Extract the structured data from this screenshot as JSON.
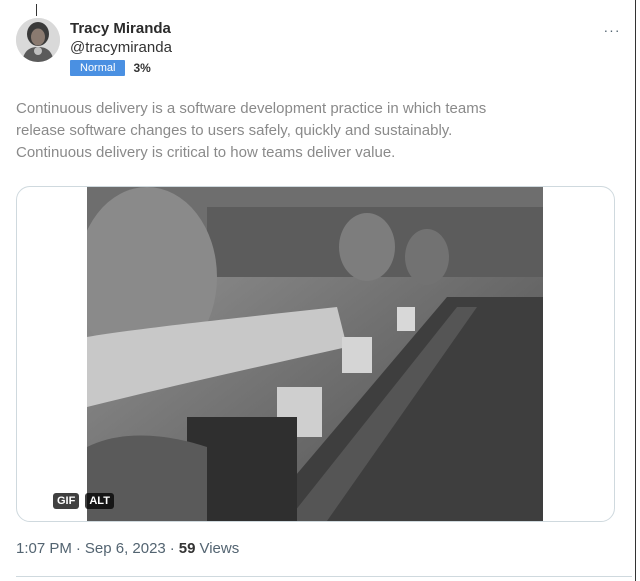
{
  "author": {
    "display_name": "Tracy Miranda",
    "handle": "@tracymiranda",
    "badge": "Normal",
    "score": "3%"
  },
  "more_button": {
    "label": "···",
    "icon": "more-horizontal-icon"
  },
  "tweet": {
    "text": "Continuous delivery is a software development practice in which teams\nrelease software changes to users safely, quickly and sustainably.\nContinuous delivery is critical to how teams deliver value."
  },
  "media": {
    "type": "gif",
    "gif_label": "GIF",
    "alt_label": "ALT",
    "play_icon": "play-icon"
  },
  "footer": {
    "time": "1:07 PM",
    "separator": "·",
    "date": "Sep 6, 2023",
    "views_count": "59",
    "views_label": "Views"
  }
}
